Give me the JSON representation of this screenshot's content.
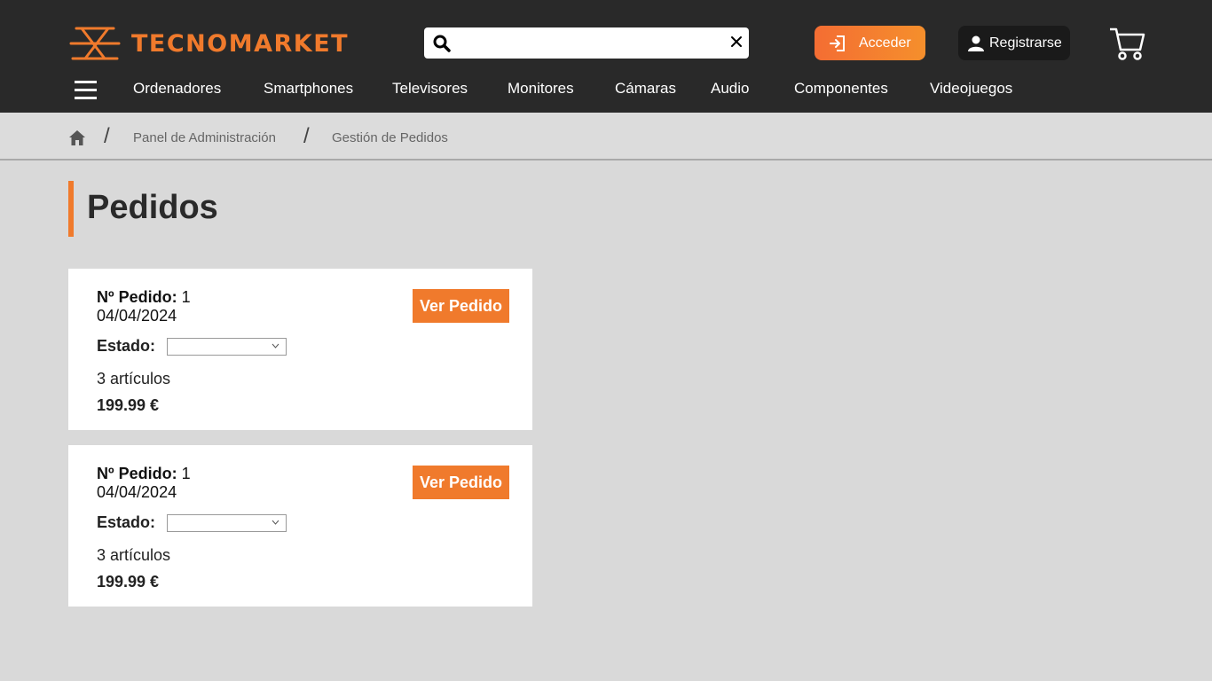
{
  "brand": {
    "name": "TECNOMARKET",
    "accent": "#f07a2c",
    "header_bg": "#292929"
  },
  "search": {
    "value": "",
    "placeholder": ""
  },
  "header": {
    "login_label": "Acceder",
    "register_label": "Registrarse"
  },
  "nav": {
    "items": [
      {
        "label": "Ordenadores"
      },
      {
        "label": "Smartphones"
      },
      {
        "label": "Televisores"
      },
      {
        "label": "Monitores"
      },
      {
        "label": "Cámaras"
      },
      {
        "label": "Audio"
      },
      {
        "label": "Componentes"
      },
      {
        "label": "Videojuegos"
      }
    ]
  },
  "breadcrumb": {
    "separator": "/",
    "items": [
      {
        "label": "Panel de Administración"
      },
      {
        "label": "Gestión de Pedidos"
      }
    ]
  },
  "page": {
    "title": "Pedidos"
  },
  "orders": [
    {
      "number_label": "Nº Pedido:",
      "number": "1",
      "date": "04/04/2024",
      "status_label": "Estado:",
      "status_value": "",
      "items_text": "3 artículos",
      "total": "199.99 €",
      "view_label": "Ver Pedido"
    },
    {
      "number_label": "Nº Pedido:",
      "number": "1",
      "date": "04/04/2024",
      "status_label": "Estado:",
      "status_value": "",
      "items_text": "3 artículos",
      "total": "199.99 €",
      "view_label": "Ver Pedido"
    }
  ]
}
